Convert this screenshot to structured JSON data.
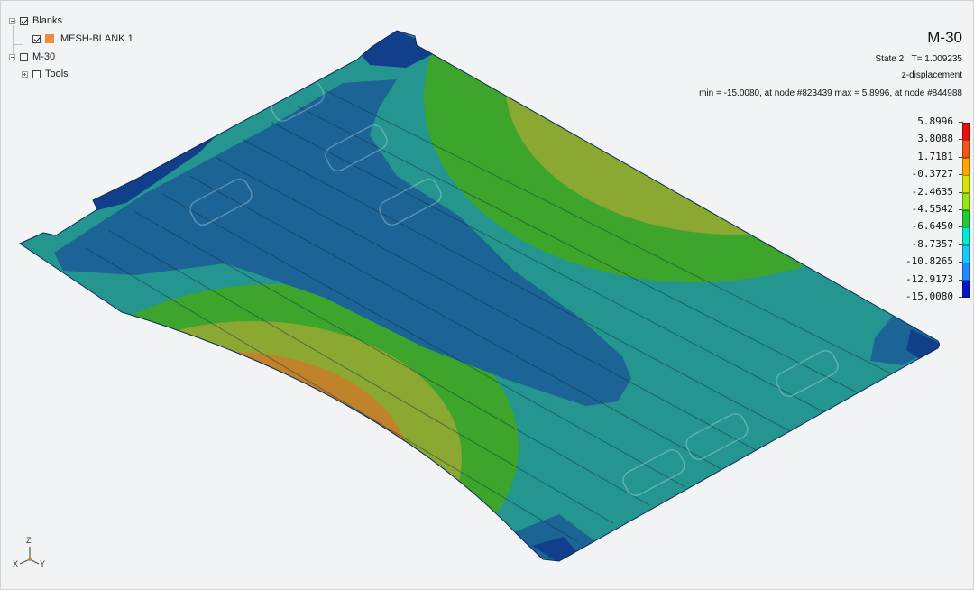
{
  "tree": {
    "items": [
      {
        "label": "Blanks",
        "checked": true,
        "level": 0
      },
      {
        "label": "MESH-BLANK.1",
        "checked": true,
        "level": 1,
        "swatch": "#f08c3c"
      },
      {
        "label": "M-30",
        "checked": false,
        "level": 0
      },
      {
        "label": "Tools",
        "checked": false,
        "level": 1
      }
    ]
  },
  "viewport": {
    "title": "M-30",
    "state_label": "State 2",
    "time_label": "T= 1.009235",
    "result_name": "z-displacement",
    "minmax_text": "min = -15.0080, at node #823439  max = 5.8996, at node #844988"
  },
  "legend": {
    "labels": [
      "5.8996",
      "3.8088",
      "1.7181",
      "-0.3727",
      "-2.4635",
      "-4.5542",
      "-6.6450",
      "-8.7357",
      "-10.8265",
      "-12.9173",
      "-15.0080"
    ],
    "colors": [
      "#e81010",
      "#f2561a",
      "#ffa500",
      "#d7e10a",
      "#98e614",
      "#24c832",
      "#00ebd2",
      "#19c8ff",
      "#1e8cff",
      "#1e55e6",
      "#0a14c3"
    ]
  },
  "contour_colors": {
    "dark_blue": "#123f8c",
    "blue": "#1c6496",
    "teal": "#24968f",
    "green": "#3ea52c",
    "yellow_green": "#8aa832",
    "orange": "#c0822a",
    "red": "#a6160e"
  },
  "triad": {
    "z": "Z",
    "x": "X",
    "y": "Y"
  }
}
